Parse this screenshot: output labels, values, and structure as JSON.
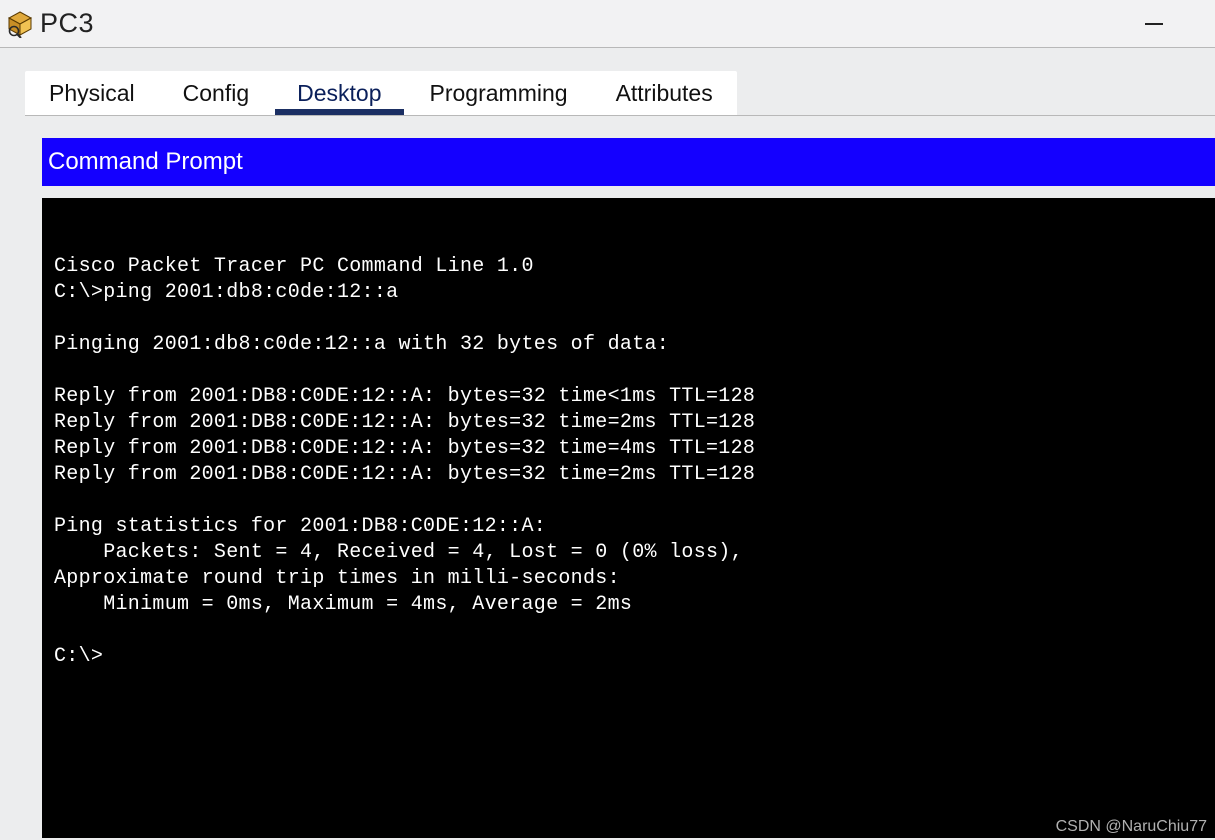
{
  "window": {
    "title": "PC3"
  },
  "tabs": {
    "items": [
      {
        "label": "Physical",
        "active": false
      },
      {
        "label": "Config",
        "active": false
      },
      {
        "label": "Desktop",
        "active": true
      },
      {
        "label": "Programming",
        "active": false
      },
      {
        "label": "Attributes",
        "active": false
      }
    ]
  },
  "panel": {
    "title": "Command Prompt"
  },
  "terminal": {
    "lines": [
      "",
      "Cisco Packet Tracer PC Command Line 1.0",
      "C:\\>ping 2001:db8:c0de:12::a",
      "",
      "Pinging 2001:db8:c0de:12::a with 32 bytes of data:",
      "",
      "Reply from 2001:DB8:C0DE:12::A: bytes=32 time<1ms TTL=128",
      "Reply from 2001:DB8:C0DE:12::A: bytes=32 time=2ms TTL=128",
      "Reply from 2001:DB8:C0DE:12::A: bytes=32 time=4ms TTL=128",
      "Reply from 2001:DB8:C0DE:12::A: bytes=32 time=2ms TTL=128",
      "",
      "Ping statistics for 2001:DB8:C0DE:12::A:",
      "    Packets: Sent = 4, Received = 4, Lost = 0 (0% loss),",
      "Approximate round trip times in milli-seconds:",
      "    Minimum = 0ms, Maximum = 4ms, Average = 2ms",
      "",
      "C:\\>"
    ]
  },
  "watermark": "CSDN @NaruChiu77"
}
